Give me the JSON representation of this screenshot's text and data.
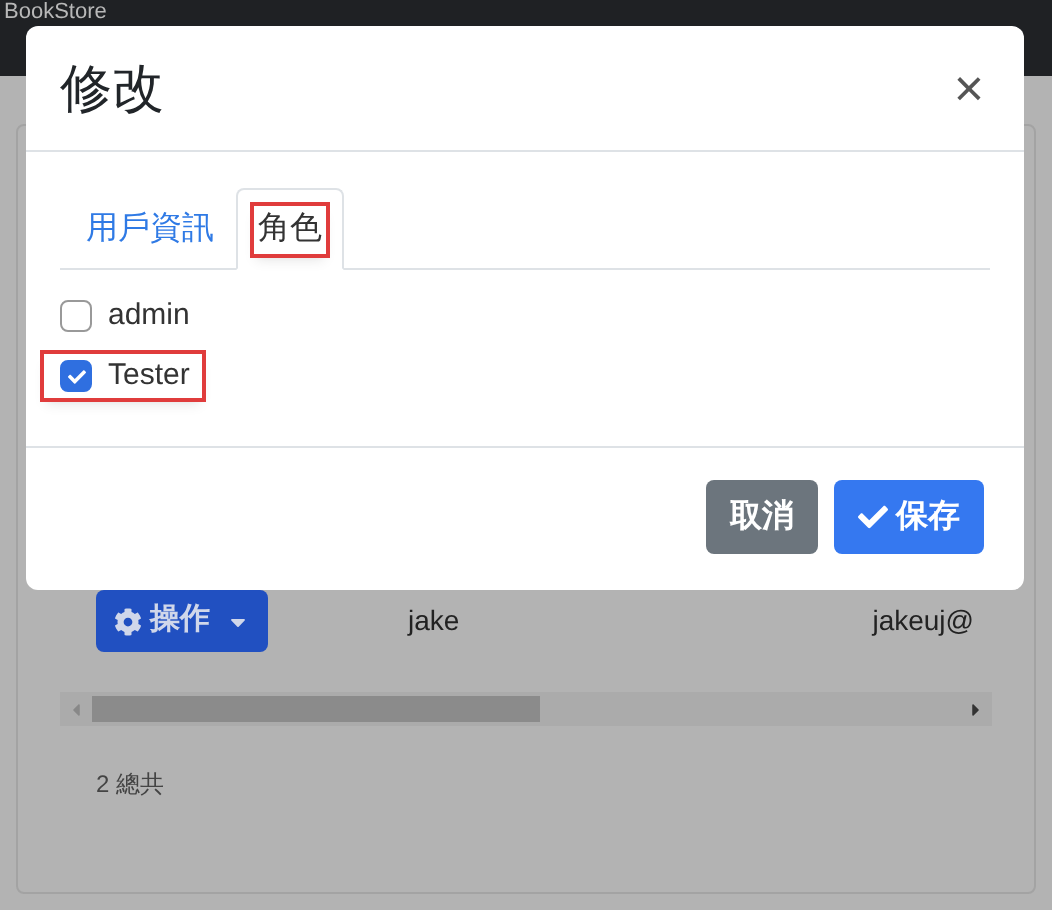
{
  "navbar": {
    "brand": "BookStore"
  },
  "modal": {
    "title": "修改",
    "close": "×",
    "tabs": [
      {
        "label": "用戶資訊",
        "selected": false,
        "highlighted": false
      },
      {
        "label": "角色",
        "selected": true,
        "highlighted": true
      }
    ],
    "roles": [
      {
        "label": "admin",
        "checked": false,
        "highlighted": false
      },
      {
        "label": "Tester",
        "checked": true,
        "highlighted": true
      }
    ],
    "buttons": [
      {
        "label": "取消",
        "kind": "secondary"
      },
      {
        "label": "保存",
        "kind": "primary"
      }
    ]
  },
  "table": {
    "action_button": "操作",
    "rows": [
      {
        "column_1": "jake",
        "column_2": "jakeuj@"
      }
    ],
    "total": "2 總共"
  }
}
